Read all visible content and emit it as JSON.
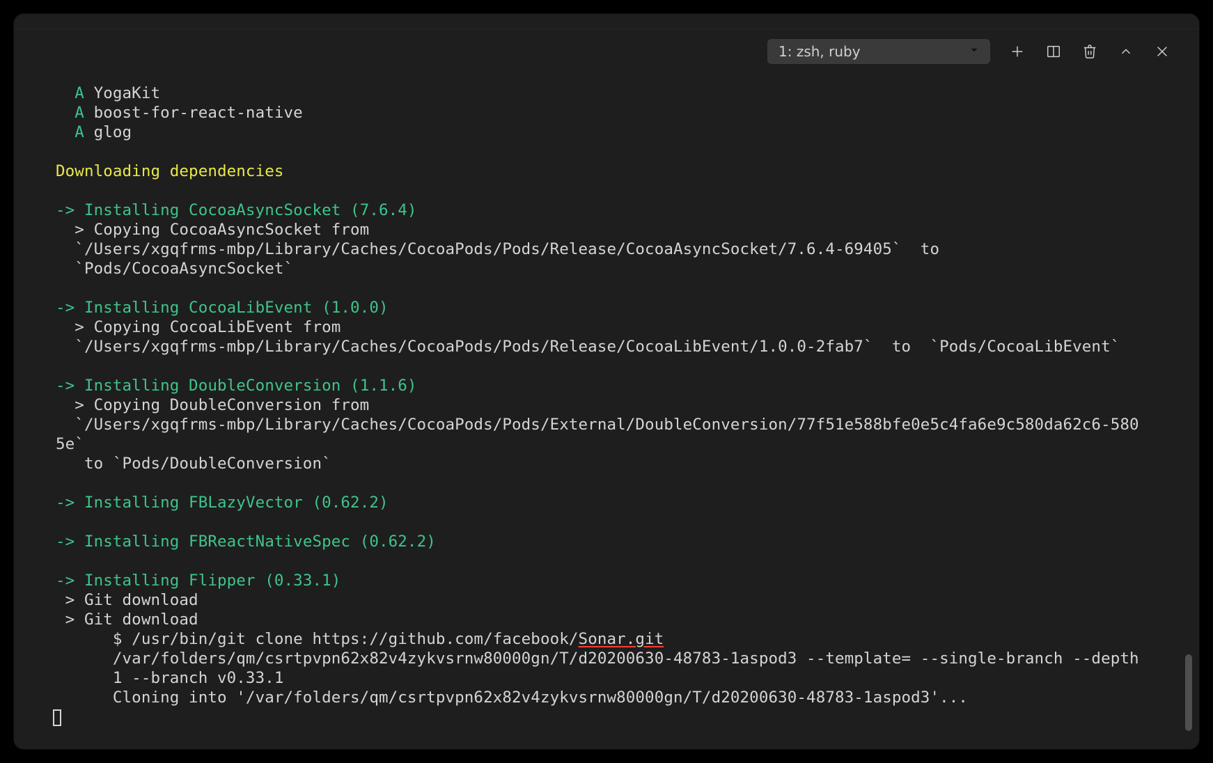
{
  "toolbar": {
    "shell_label": "1: zsh, ruby"
  },
  "term": {
    "added": [
      "YogaKit",
      "boost-for-react-native",
      "glog"
    ],
    "added_prefix": "A ",
    "downloading_header": "Downloading dependencies",
    "arrow": "-> ",
    "inst_cocoa_async": "Installing CocoaAsyncSocket (7.6.4)",
    "copy_cocoa_async_1": "  > Copying CocoaAsyncSocket from",
    "copy_cocoa_async_2": "  `/Users/xgqfrms-mbp/Library/Caches/CocoaPods/Pods/Release/CocoaAsyncSocket/7.6.4-69405`  to",
    "copy_cocoa_async_3": "  `Pods/CocoaAsyncSocket`",
    "inst_cocoa_lib": "Installing CocoaLibEvent (1.0.0)",
    "copy_cocoa_lib_1": "  > Copying CocoaLibEvent from",
    "copy_cocoa_lib_2": "  `/Users/xgqfrms-mbp/Library/Caches/CocoaPods/Pods/Release/CocoaLibEvent/1.0.0-2fab7`  to  `Pods/CocoaLibEvent`",
    "inst_double": "Installing DoubleConversion (1.1.6)",
    "copy_double_1": "  > Copying DoubleConversion from",
    "copy_double_2": "  `/Users/xgqfrms-mbp/Library/Caches/CocoaPods/Pods/External/DoubleConversion/77f51e588bfe0e5c4fa6e9c580da62c6-580",
    "copy_double_3": "5e`",
    "copy_double_4": "   to `Pods/DoubleConversion`",
    "inst_fblazy": "Installing FBLazyVector (0.62.2)",
    "inst_fbreact": "Installing FBReactNativeSpec (0.62.2)",
    "inst_flipper": "Installing Flipper (0.33.1)",
    "git_dl_1": " > Git download",
    "git_dl_2": " > Git download",
    "git_clone_pre": "      $ /usr/bin/git clone https://github.com/facebook/",
    "git_clone_underlined": "Sonar.git",
    "git_clone_folders": "      /var/folders/qm/csrtpvpn62x82v4zykvsrnw80000gn/T/d20200630-48783-1aspod3 --template= --single-branch --depth",
    "git_clone_branch": "      1 --branch v0.33.1",
    "cloning_into": "      Cloning into '/var/folders/qm/csrtpvpn62x82v4zykvsrnw80000gn/T/d20200630-48783-1aspod3'..."
  }
}
